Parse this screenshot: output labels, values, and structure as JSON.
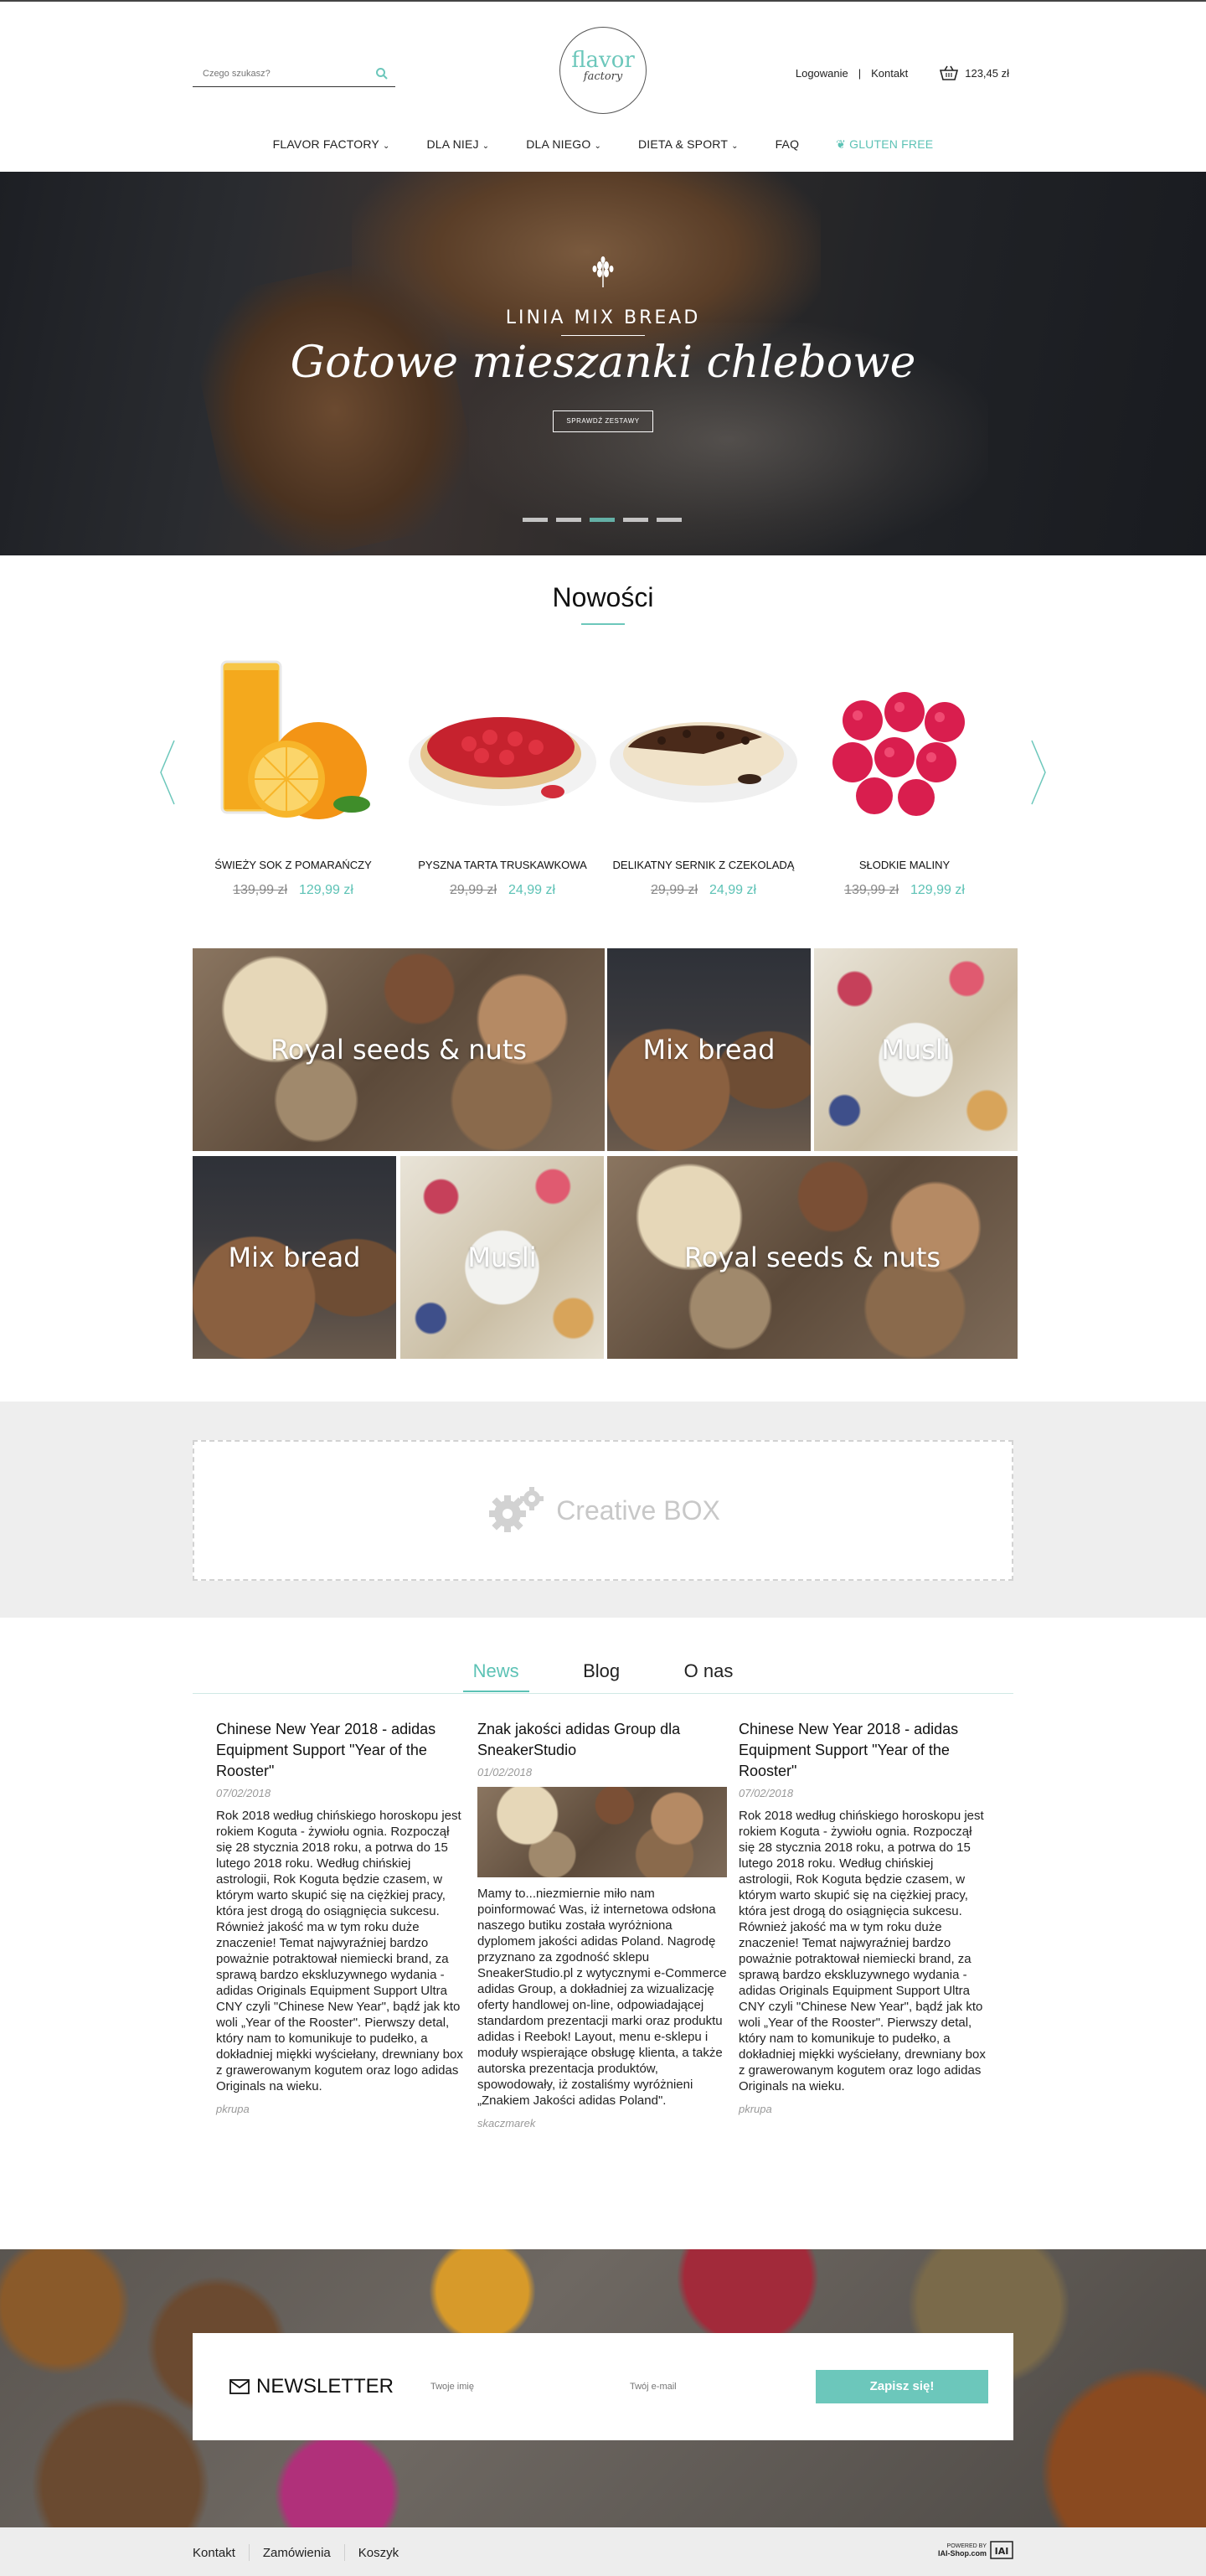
{
  "search": {
    "placeholder": "Czego szukasz?"
  },
  "logo": {
    "line1": "flavor",
    "line2": "factory"
  },
  "toplinks": {
    "login": "Logowanie",
    "contact": "Kontakt",
    "cart_total": "123,45 zł"
  },
  "nav": [
    {
      "label": "FLAVOR FACTORY",
      "chevron": true
    },
    {
      "label": "DLA NIEJ",
      "chevron": true
    },
    {
      "label": "DLA NIEGO",
      "chevron": true
    },
    {
      "label": "DIETA & SPORT",
      "chevron": true
    },
    {
      "label": "FAQ",
      "chevron": false
    },
    {
      "label": "GLUTEN FREE",
      "chevron": false,
      "icon": "leaf-icon"
    }
  ],
  "hero": {
    "line1": "LINIA MIX BREAD",
    "line2": "Gotowe mieszanki chlebowe",
    "button": "SPRAWDŹ ZESTAWY",
    "slides": 5,
    "active_slide": 3
  },
  "new_section": {
    "title": "Nowości"
  },
  "products": [
    {
      "name": "ŚWIEŻY SOK Z POMARAŃCZY",
      "old_price": "139,99 zł",
      "price": "129,99 zł",
      "image": "orange-juice"
    },
    {
      "name": "PYSZNA TARTA TRUSKAWKOWA",
      "old_price": "29,99 zł",
      "price": "24,99 zł",
      "image": "strawberry-tart"
    },
    {
      "name": "DELIKATNY SERNIK Z CZEKOLADĄ",
      "old_price": "29,99 zł",
      "price": "24,99 zł",
      "image": "chocolate-cheesecake"
    },
    {
      "name": "SŁODKIE MALINY",
      "old_price": "139,99 zł",
      "price": "129,99 zł",
      "image": "raspberries"
    }
  ],
  "tiles": [
    {
      "label": "Royal seeds & nuts"
    },
    {
      "label": "Mix bread"
    },
    {
      "label": "Musli"
    },
    {
      "label": "Mix bread"
    },
    {
      "label": "Musli"
    },
    {
      "label": "Royal seeds & nuts"
    }
  ],
  "creative_box": {
    "label": "Creative BOX"
  },
  "tabs": [
    {
      "label": "News",
      "active": true
    },
    {
      "label": "Blog",
      "active": false
    },
    {
      "label": "O nas",
      "active": false
    }
  ],
  "articles": [
    {
      "title": "Chinese New Year 2018 - adidas Equipment Support \"Year of the Rooster\"",
      "date": "07/02/2018",
      "body": "Rok 2018 według chińskiego horoskopu jest rokiem Koguta - żywiołu ognia. Rozpoczął się 28 stycznia 2018 roku, a potrwa do 15 lutego 2018 roku. Według chińskiej astrologii, Rok Koguta będzie czasem, w którym warto skupić się na ciężkiej pracy, która jest drogą do osiągnięcia sukcesu. Również jakość ma w tym roku duże znaczenie! Temat najwyraźniej bardzo poważnie potraktował niemiecki brand, za sprawą bardzo ekskluzywnego wydania - adidas Originals Equipment Support Ultra CNY czyli \"Chinese New Year\", bądź jak kto woli „Year of the Rooster\". Pierwszy detal, który nam to komunikuje to pudełko, a dokładniej miękki wyściełany, drewniany box z grawerowanym kogutem oraz logo adidas Originals na wieku.",
      "author": "pkrupa"
    },
    {
      "title": "Znak jakości adidas Group dla SneakerStudio",
      "date": "01/02/2018",
      "body": "Mamy to...niezmiernie miło nam poinformować Was, iż internetowa odsłona naszego butiku została wyróżniona dyplomem jakości adidas Poland. Nagrodę przyznano za zgodność sklepu SneakerStudio.pl z wytycznymi e-Commerce adidas Group, a dokładniej za wizualizację oferty handlowej on-line, odpowiadającej standardom prezentacji marki oraz produktu adidas i Reebok! Layout, menu e-sklepu i moduły wspierające obsługę klienta, a także autorska prezentacja produktów, spowodowały, iż zostaliśmy wyróżnieni „Znakiem Jakości adidas Poland\".",
      "author": "skaczmarek"
    },
    {
      "title": "Chinese New Year 2018 - adidas Equipment Support \"Year of the Rooster\"",
      "date": "07/02/2018",
      "body": "Rok 2018 według chińskiego horoskopu jest rokiem Koguta - żywiołu ognia. Rozpoczął się 28 stycznia 2018 roku, a potrwa do 15 lutego 2018 roku. Według chińskiej astrologii, Rok Koguta będzie czasem, w którym warto skupić się na ciężkiej pracy, która jest drogą do osiągnięcia sukcesu. Również jakość ma w tym roku duże znaczenie! Temat najwyraźniej bardzo poważnie potraktował niemiecki brand, za sprawą bardzo ekskluzywnego wydania - adidas Originals Equipment Support Ultra CNY czyli \"Chinese New Year\", bądź jak kto woli „Year of the Rooster\". Pierwszy detal, który nam to komunikuje to pudełko, a dokładniej miękki wyściełany, drewniany box z grawerowanym kogutem oraz logo adidas Originals na wieku.",
      "author": "pkrupa"
    }
  ],
  "newsletter": {
    "title": "NEWSLETTER",
    "name_placeholder": "Twoje imię",
    "email_placeholder": "Twój e-mail",
    "button": "Zapisz się!"
  },
  "footer": {
    "links": [
      "Kontakt",
      "Zamówienia",
      "Koszyk"
    ],
    "powered_line1": "POWERED BY",
    "powered_line2": "IAI-Shop.com",
    "powered_logo": "IAI"
  },
  "colors": {
    "accent": "#6cc7bb",
    "price": "#5cc2b5",
    "creative_box_text": "#c8c8c8"
  }
}
